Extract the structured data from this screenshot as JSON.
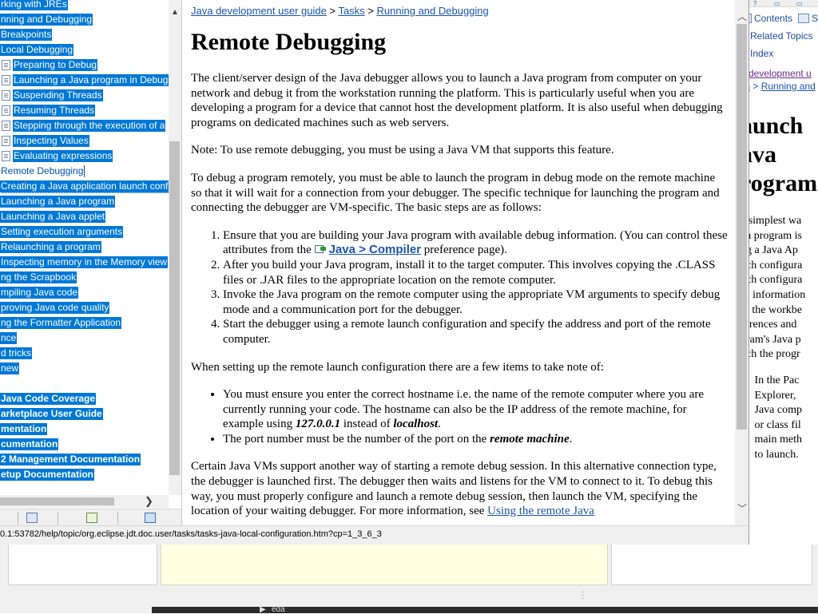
{
  "toc": {
    "items": [
      {
        "label": "rking with JREs",
        "indent": 0,
        "icon": false,
        "bold": false
      },
      {
        "label": "nning and Debugging",
        "indent": 0,
        "icon": false,
        "bold": false
      },
      {
        "label": "Breakpoints",
        "indent": 0,
        "icon": false,
        "bold": false
      },
      {
        "label": "Local Debugging",
        "indent": 0,
        "icon": false,
        "bold": false
      },
      {
        "label": "Preparing to Debug",
        "indent": 1,
        "icon": true,
        "bold": false
      },
      {
        "label": "Launching a Java program in Debug",
        "indent": 1,
        "icon": true,
        "bold": false
      },
      {
        "label": "Suspending Threads",
        "indent": 1,
        "icon": true,
        "bold": false
      },
      {
        "label": "Resuming Threads",
        "indent": 1,
        "icon": true,
        "bold": false
      },
      {
        "label": "Stepping through the execution of a",
        "indent": 1,
        "icon": true,
        "bold": false
      },
      {
        "label": "Inspecting Values",
        "indent": 1,
        "icon": true,
        "bold": false
      },
      {
        "label": "Evaluating expressions",
        "indent": 1,
        "icon": true,
        "bold": false
      },
      {
        "label": "Remote Debugging",
        "indent": 0,
        "icon": false,
        "bold": false,
        "selected": true
      },
      {
        "label": "Creating a Java application launch confi",
        "indent": 0,
        "icon": false,
        "bold": false
      },
      {
        "label": "Launching a Java program",
        "indent": 0,
        "icon": false,
        "bold": false
      },
      {
        "label": "Launching a Java applet",
        "indent": 0,
        "icon": false,
        "bold": false
      },
      {
        "label": "Setting execution arguments",
        "indent": 0,
        "icon": false,
        "bold": false
      },
      {
        "label": "Relaunching a program",
        "indent": 0,
        "icon": false,
        "bold": false
      },
      {
        "label": "Inspecting memory in the Memory view",
        "indent": 0,
        "icon": false,
        "bold": false
      },
      {
        "label": "ng the Scrapbook",
        "indent": 0,
        "icon": false,
        "bold": false
      },
      {
        "label": "mpiling Java code",
        "indent": 0,
        "icon": false,
        "bold": false
      },
      {
        "label": "proving Java code quality",
        "indent": 0,
        "icon": false,
        "bold": false
      },
      {
        "label": "ng the Formatter Application",
        "indent": 0,
        "icon": false,
        "bold": false
      },
      {
        "label": "nce",
        "indent": 0,
        "icon": false,
        "bold": false
      },
      {
        "label": "d tricks",
        "indent": 0,
        "icon": false,
        "bold": false
      },
      {
        "label": " new",
        "indent": 0,
        "icon": false,
        "bold": false
      },
      {
        "label": "",
        "indent": 0,
        "icon": false,
        "bold": false
      },
      {
        "label": "Java Code Coverage",
        "indent": 0,
        "icon": false,
        "bold": true
      },
      {
        "label": "arketplace User Guide",
        "indent": 0,
        "icon": false,
        "bold": true
      },
      {
        "label": "mentation",
        "indent": 0,
        "icon": false,
        "bold": true
      },
      {
        "label": "cumentation",
        "indent": 0,
        "icon": false,
        "bold": true
      },
      {
        "label": "2 Management Documentation",
        "indent": 0,
        "icon": false,
        "bold": true
      },
      {
        "label": "etup Documentation",
        "indent": 0,
        "icon": false,
        "bold": true
      }
    ]
  },
  "content": {
    "breadcrumb": [
      "Java development user guide",
      "Tasks",
      "Running and Debugging"
    ],
    "breadcrumb_sep": ">",
    "title": "Remote Debugging",
    "intro": "The client/server design of the Java debugger allows you to launch a Java program from computer on your network and debug it from the workstation running the platform.  This is particularly useful when you are developing a program for a device that cannot host the development platform.  It is also useful when debugging programs on dedicated machines such as web servers.",
    "note": "Note:  To use remote debugging, you must be using a Java VM that supports this feature.",
    "how": "To debug a program remotely, you must be able to launch the program in debug mode on the remote machine so that it will wait for a connection from your debugger.  The specific technique for launching the program and connecting the debugger are VM-specific.  The basic steps are as follows:",
    "steps": {
      "s1_pre": "Ensure that you are building your Java program with available debug information.  (You can control these attributes from the ",
      "s1_link": "Java > Compiler",
      "s1_post": " preference page).",
      "s2": "After you build your Java program, install it to the target computer.  This involves copying the .CLASS files or .JAR files to the appropriate location on the remote computer.",
      "s3": "Invoke the Java program on the remote computer using the appropriate VM arguments to specify debug mode and a communication port for the debugger.",
      "s4": "Start the debugger using a remote launch configuration and specify the address and port of the remote computer."
    },
    "setup": "When setting up the remote launch configuration there are a few items to take note of:",
    "bullets": {
      "b1_pre": "You must ensure you enter the correct hostname i.e. the name of the remote computer where you are currently running your code. The hostname can also be the IP address of the remote machine, for example using ",
      "b1_ip": "127.0.0.1",
      "b1_mid": " instead of ",
      "b1_host": "localhost",
      "b1_post": ".",
      "b2_pre": "The port number must be the number of the port on the ",
      "b2_em": "remote machine",
      "b2_post": "."
    },
    "alt_pre": "Certain Java VMs support another way of starting a remote debug session. In this alternative connection type, the debugger is launched first. The debugger then waits and listens for the VM to connect to it. To debug this way, you must properly configure and launch a remote debug session, then launch the VM, specifying the location of your waiting debugger. For more information, see ",
    "alt_link": "Using the remote Java"
  },
  "status": {
    "url": "0.1:53782/help/topic/org.eclipse.jdt.doc.user/tasks/tasks-java-local-configuration.htm?cp=1_3_6_3"
  },
  "bgwin": {
    "nav": [
      "Contents",
      "Search",
      "Related Topics",
      "Index"
    ],
    "breadcrumb": [
      "a development u",
      "ks",
      "Running and"
    ],
    "title": "aunch\nava\nrogram",
    "para": "e simplest wa\nva program is\nng a Java Ap\nnch configura\nnch configura\nes information\nm the workbe\nferences and\ngram's Java p\nnch the progr",
    "step": "1.  In the Pac\n     Explorer,\n     Java comp\n     or class fil\n     main meth\n     to launch."
  },
  "taskbar": {
    "label": "eda"
  },
  "colors": {
    "selection": "#0078d7",
    "link": "#1a53b0",
    "tooltip_bg": "#ffffe1"
  }
}
